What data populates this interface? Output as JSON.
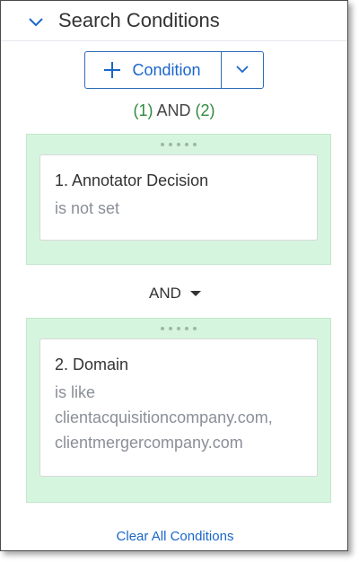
{
  "header": {
    "title": "Search Conditions",
    "collapse_icon": "chevron-down-icon"
  },
  "add_button": {
    "label": "Condition",
    "icon": "plus-icon",
    "dropdown_icon": "chevron-down-icon"
  },
  "logic": {
    "open1": "(1)",
    "and": "AND",
    "open2": "(2)"
  },
  "groups": [
    {
      "name": "1. Annotator Decision",
      "operator": "is not set",
      "values": []
    },
    {
      "name": "2. Domain",
      "operator": "is like",
      "values": [
        "clientacquisitioncompany.com,",
        "clientmergercompany.com"
      ]
    }
  ],
  "operator_between": {
    "label": "AND",
    "icon": "caret-down-icon"
  },
  "footer": {
    "clear_label": "Clear All Conditions"
  },
  "colors": {
    "accent": "#1b66c9",
    "group_bg": "#d6f5df",
    "number_green": "#2e8b3e"
  }
}
